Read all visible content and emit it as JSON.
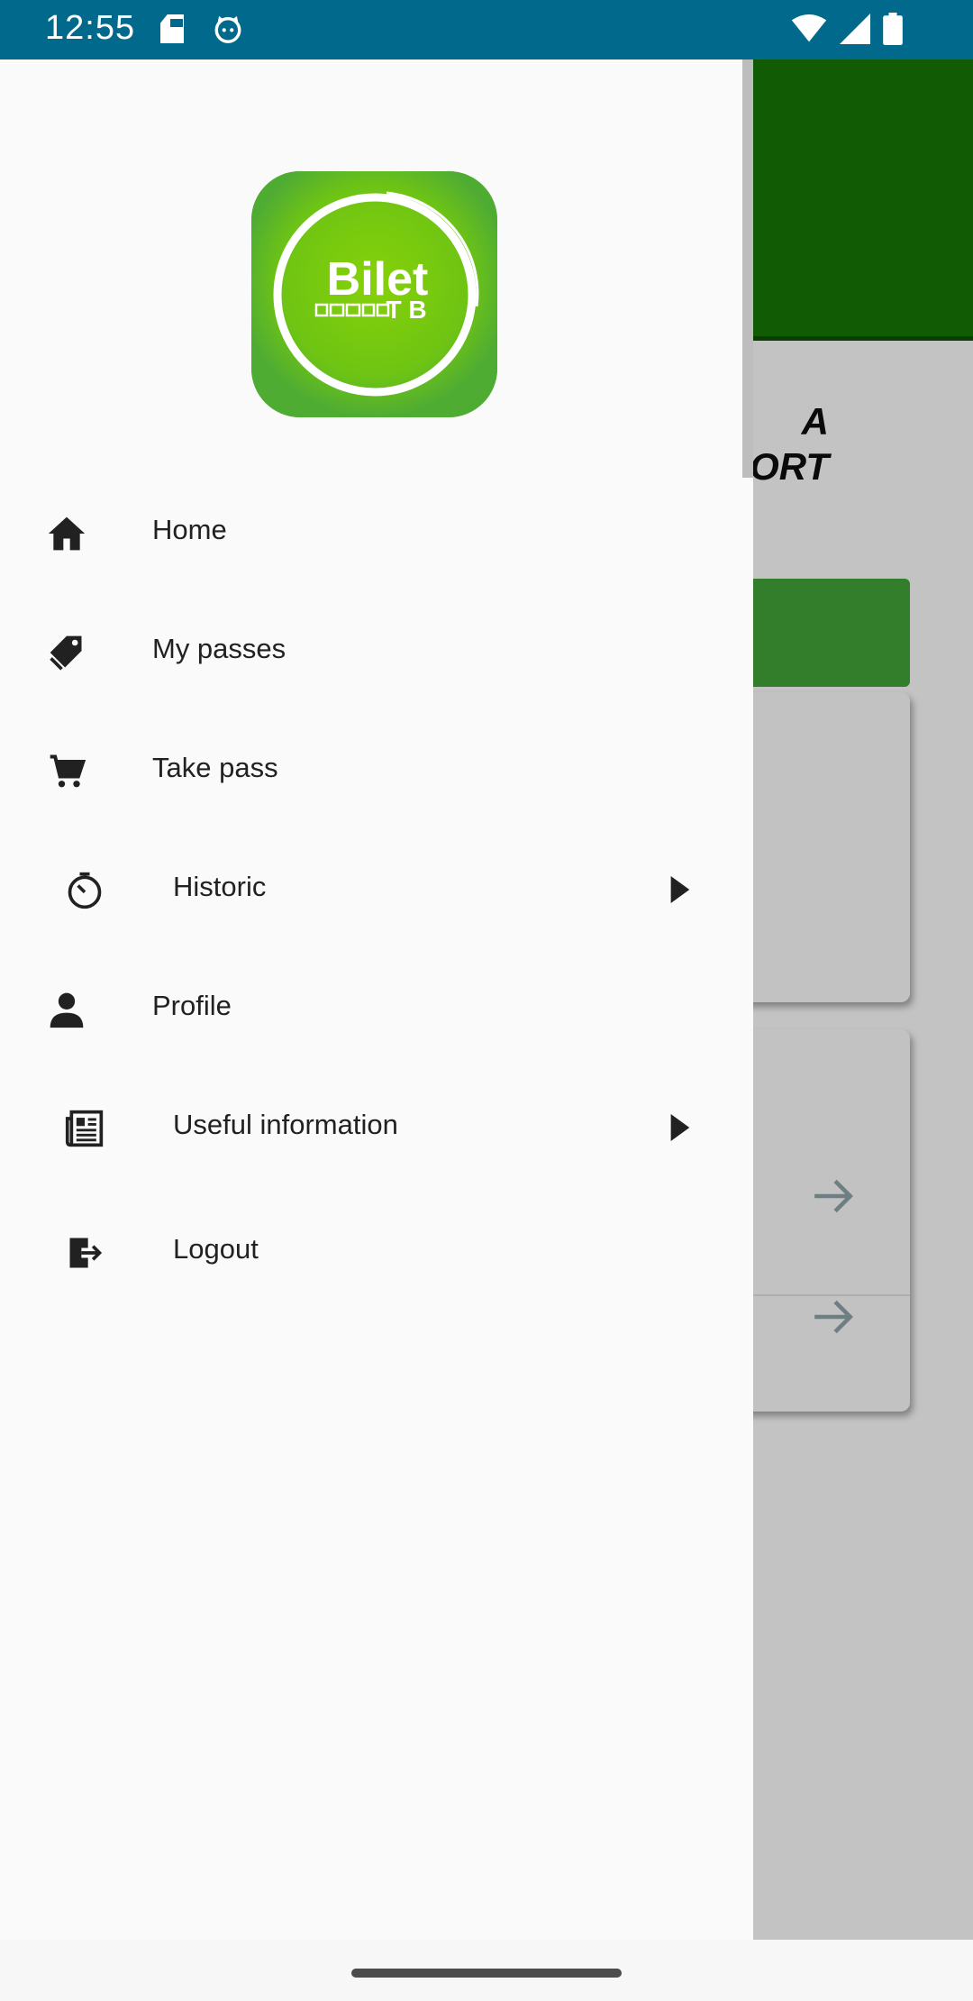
{
  "status_bar": {
    "time": "12:55",
    "icons": [
      "sd-card-icon",
      "cat-icon",
      "wifi-icon",
      "signal-icon",
      "battery-icon"
    ]
  },
  "background_app": {
    "title_line1": "A",
    "title_line2": "ORT"
  },
  "drawer": {
    "logo": {
      "text": "Bilet",
      "sub": "T B"
    },
    "items": [
      {
        "label": "Home",
        "icon": "home-icon"
      },
      {
        "label": "My passes",
        "icon": "tag-icon"
      },
      {
        "label": "Take pass",
        "icon": "cart-icon"
      },
      {
        "label": "Historic",
        "icon": "timer-icon",
        "expandable": true
      },
      {
        "label": "Profile",
        "icon": "person-icon"
      },
      {
        "label": "Useful information",
        "icon": "newspaper-icon",
        "expandable": true
      },
      {
        "label": "Logout",
        "icon": "logout-icon"
      }
    ]
  },
  "colors": {
    "status_bar": "#016a8c",
    "drawer_bg": "#fafafa",
    "brand_green": "#4fac33",
    "header_green": "#125b05",
    "scrim": "#c3c3c3"
  }
}
